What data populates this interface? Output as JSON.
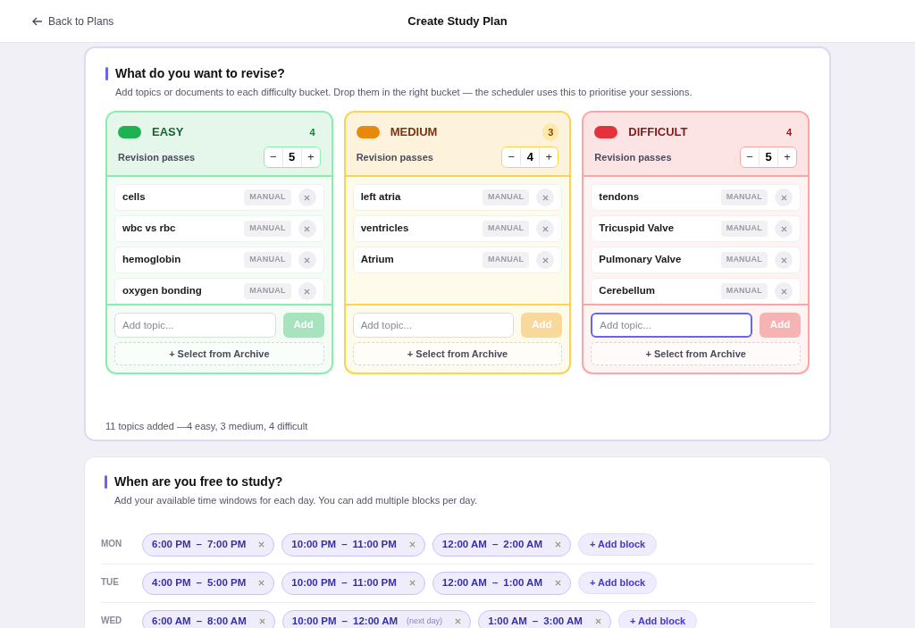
{
  "header": {
    "back": "Back to Plans",
    "title": "Create Study Plan"
  },
  "revise": {
    "title": "What do you want to revise?",
    "subtitle": "Add topics or documents to each difficulty bucket. Drop them in the right bucket — the scheduler uses this to prioritise your sessions.",
    "buckets": [
      {
        "kind": "easy",
        "color": "#1fb254",
        "label": "EASY",
        "count": "4",
        "passes_label": "Revision passes",
        "passes": "5",
        "minus": "−",
        "plus": "+",
        "topics": [
          {
            "name": "cells",
            "tag": "MANUAL"
          },
          {
            "name": "wbc vs rbc",
            "tag": "MANUAL"
          },
          {
            "name": "hemoglobin",
            "tag": "MANUAL"
          },
          {
            "name": "oxygen bonding",
            "tag": "MANUAL"
          }
        ],
        "placeholder": "Add topic...",
        "focused": false,
        "add": "Add",
        "archive": "+ Select from Archive"
      },
      {
        "kind": "medium",
        "color": "#e8890c",
        "label": "MEDIUM",
        "count": "3",
        "passes_label": "Revision passes",
        "passes": "4",
        "minus": "−",
        "plus": "+",
        "topics": [
          {
            "name": "left atria",
            "tag": "MANUAL"
          },
          {
            "name": "ventricles",
            "tag": "MANUAL"
          },
          {
            "name": "Atrium",
            "tag": "MANUAL"
          }
        ],
        "placeholder": "Add topic...",
        "focused": false,
        "add": "Add",
        "archive": "+ Select from Archive"
      },
      {
        "kind": "difficult",
        "color": "#e5323a",
        "label": "DIFFICULT",
        "count": "4",
        "passes_label": "Revision passes",
        "passes": "5",
        "minus": "−",
        "plus": "+",
        "topics": [
          {
            "name": "tendons",
            "tag": "MANUAL"
          },
          {
            "name": "Tricuspid Valve",
            "tag": "MANUAL"
          },
          {
            "name": "Pulmonary Valve",
            "tag": "MANUAL"
          },
          {
            "name": "Cerebellum",
            "tag": "MANUAL"
          }
        ],
        "placeholder": "Add topic...",
        "focused": true,
        "add": "Add",
        "archive": "+ Select from Archive"
      }
    ],
    "summary": "11 topics added —4 easy, 3 medium, 4 difficult"
  },
  "availability": {
    "title": "When are you free to study?",
    "subtitle": "Add your available time windows for each day. You can add multiple blocks per day.",
    "days": [
      {
        "day": "MON",
        "blocks": [
          {
            "from": "6:00 PM",
            "sep": "–",
            "to": "7:00 PM"
          },
          {
            "from": "10:00 PM",
            "sep": "–",
            "to": "11:00 PM"
          },
          {
            "from": "12:00 AM",
            "sep": "–",
            "to": "2:00 AM"
          }
        ],
        "add": "+ Add block"
      },
      {
        "day": "TUE",
        "blocks": [
          {
            "from": "4:00 PM",
            "sep": "–",
            "to": "5:00 PM"
          },
          {
            "from": "10:00 PM",
            "sep": "–",
            "to": "11:00 PM"
          },
          {
            "from": "12:00 AM",
            "sep": "–",
            "to": "1:00 AM"
          }
        ],
        "add": "+ Add block"
      },
      {
        "day": "WED",
        "blocks": [
          {
            "from": "6:00 AM",
            "sep": "–",
            "to": "8:00 AM"
          },
          {
            "from": "10:00 PM",
            "sep": "–",
            "to": "12:00 AM",
            "note": "(next day)"
          },
          {
            "from": "1:00 AM",
            "sep": "–",
            "to": "3:00 AM"
          }
        ],
        "add": "+ Add block"
      }
    ]
  }
}
